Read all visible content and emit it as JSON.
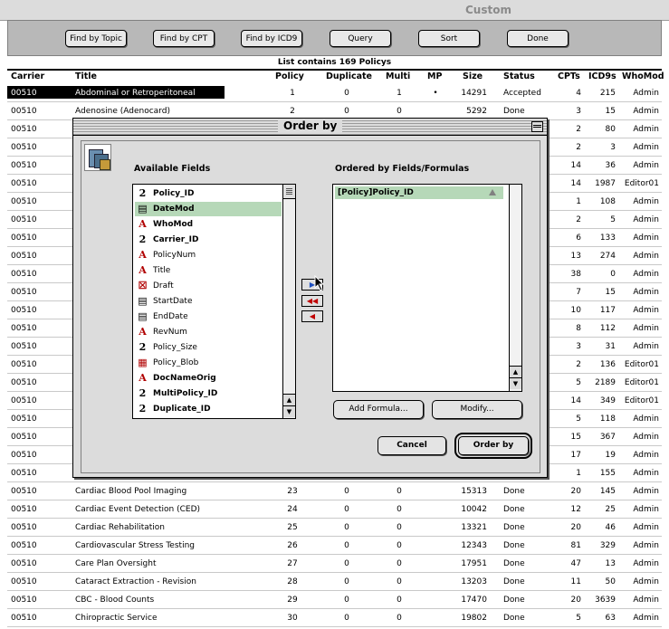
{
  "window": {
    "title": "Custom"
  },
  "toolbar": {
    "buttons": [
      "Find by Topic",
      "Find by CPT",
      "Find by ICD9",
      "Query",
      "Sort",
      "Done"
    ]
  },
  "list_status": "List contains 169 Policys",
  "columns": [
    "Carrier",
    "Title",
    "Policy",
    "Duplicate",
    "Multi",
    "MP",
    "Size",
    "Status",
    "CPTs",
    "ICD9s",
    "WhoMod"
  ],
  "rows": [
    {
      "carrier": "00510",
      "title": "Abdominal or Retroperitoneal",
      "policy": "1",
      "dup": "0",
      "multi": "1",
      "mp": "•",
      "size": "14291",
      "status": "Accepted",
      "cpts": "4",
      "icd": "215",
      "who": "Admin",
      "selected": true
    },
    {
      "carrier": "00510",
      "title": "Adenosine (Adenocard)",
      "policy": "2",
      "dup": "0",
      "multi": "0",
      "mp": "",
      "size": "5292",
      "status": "Done",
      "cpts": "3",
      "icd": "15",
      "who": "Admin"
    },
    {
      "carrier": "00510",
      "title": "",
      "policy": "",
      "dup": "",
      "multi": "",
      "mp": "",
      "size": "",
      "status": "",
      "cpts": "2",
      "icd": "80",
      "who": "Admin"
    },
    {
      "carrier": "00510",
      "title": "",
      "policy": "",
      "dup": "",
      "multi": "",
      "mp": "",
      "size": "",
      "status": "",
      "cpts": "2",
      "icd": "3",
      "who": "Admin"
    },
    {
      "carrier": "00510",
      "title": "",
      "policy": "",
      "dup": "",
      "multi": "",
      "mp": "",
      "size": "",
      "status": "",
      "cpts": "14",
      "icd": "36",
      "who": "Admin"
    },
    {
      "carrier": "00510",
      "title": "",
      "policy": "",
      "dup": "",
      "multi": "",
      "mp": "",
      "size": "",
      "status": "",
      "cpts": "14",
      "icd": "1987",
      "who": "Editor01"
    },
    {
      "carrier": "00510",
      "title": "",
      "policy": "",
      "dup": "",
      "multi": "",
      "mp": "",
      "size": "",
      "status": "",
      "cpts": "1",
      "icd": "108",
      "who": "Admin"
    },
    {
      "carrier": "00510",
      "title": "",
      "policy": "",
      "dup": "",
      "multi": "",
      "mp": "",
      "size": "",
      "status": "",
      "cpts": "2",
      "icd": "5",
      "who": "Admin"
    },
    {
      "carrier": "00510",
      "title": "",
      "policy": "",
      "dup": "",
      "multi": "",
      "mp": "",
      "size": "",
      "status": "",
      "cpts": "6",
      "icd": "133",
      "who": "Admin"
    },
    {
      "carrier": "00510",
      "title": "",
      "policy": "",
      "dup": "",
      "multi": "",
      "mp": "",
      "size": "",
      "status": "",
      "cpts": "13",
      "icd": "274",
      "who": "Admin"
    },
    {
      "carrier": "00510",
      "title": "",
      "policy": "",
      "dup": "",
      "multi": "",
      "mp": "",
      "size": "",
      "status": "",
      "cpts": "38",
      "icd": "0",
      "who": "Admin"
    },
    {
      "carrier": "00510",
      "title": "",
      "policy": "",
      "dup": "",
      "multi": "",
      "mp": "",
      "size": "",
      "status": "",
      "cpts": "7",
      "icd": "15",
      "who": "Admin"
    },
    {
      "carrier": "00510",
      "title": "",
      "policy": "",
      "dup": "",
      "multi": "",
      "mp": "",
      "size": "",
      "status": "",
      "cpts": "10",
      "icd": "117",
      "who": "Admin"
    },
    {
      "carrier": "00510",
      "title": "",
      "policy": "",
      "dup": "",
      "multi": "",
      "mp": "",
      "size": "",
      "status": "",
      "cpts": "8",
      "icd": "112",
      "who": "Admin"
    },
    {
      "carrier": "00510",
      "title": "",
      "policy": "",
      "dup": "",
      "multi": "",
      "mp": "",
      "size": "",
      "status": "",
      "cpts": "3",
      "icd": "31",
      "who": "Admin"
    },
    {
      "carrier": "00510",
      "title": "",
      "policy": "",
      "dup": "",
      "multi": "",
      "mp": "",
      "size": "",
      "status": "",
      "cpts": "2",
      "icd": "136",
      "who": "Editor01"
    },
    {
      "carrier": "00510",
      "title": "",
      "policy": "",
      "dup": "",
      "multi": "",
      "mp": "",
      "size": "",
      "status": "",
      "cpts": "5",
      "icd": "2189",
      "who": "Editor01"
    },
    {
      "carrier": "00510",
      "title": "",
      "policy": "",
      "dup": "",
      "multi": "",
      "mp": "",
      "size": "",
      "status": "",
      "cpts": "14",
      "icd": "349",
      "who": "Editor01"
    },
    {
      "carrier": "00510",
      "title": "",
      "policy": "",
      "dup": "",
      "multi": "",
      "mp": "",
      "size": "",
      "status": "",
      "cpts": "5",
      "icd": "118",
      "who": "Admin"
    },
    {
      "carrier": "00510",
      "title": "",
      "policy": "",
      "dup": "",
      "multi": "",
      "mp": "",
      "size": "",
      "status": "",
      "cpts": "15",
      "icd": "367",
      "who": "Admin"
    },
    {
      "carrier": "00510",
      "title": "",
      "policy": "",
      "dup": "",
      "multi": "",
      "mp": "",
      "size": "",
      "status": "",
      "cpts": "17",
      "icd": "19",
      "who": "Admin"
    },
    {
      "carrier": "00510",
      "title": "",
      "policy": "",
      "dup": "",
      "multi": "",
      "mp": "",
      "size": "",
      "status": "",
      "cpts": "1",
      "icd": "155",
      "who": "Admin"
    },
    {
      "carrier": "00510",
      "title": "Cardiac Blood Pool Imaging",
      "policy": "23",
      "dup": "0",
      "multi": "0",
      "mp": "",
      "size": "15313",
      "status": "Done",
      "cpts": "20",
      "icd": "145",
      "who": "Admin"
    },
    {
      "carrier": "00510",
      "title": "Cardiac Event Detection (CED)",
      "policy": "24",
      "dup": "0",
      "multi": "0",
      "mp": "",
      "size": "10042",
      "status": "Done",
      "cpts": "12",
      "icd": "25",
      "who": "Admin"
    },
    {
      "carrier": "00510",
      "title": "Cardiac Rehabilitation",
      "policy": "25",
      "dup": "0",
      "multi": "0",
      "mp": "",
      "size": "13321",
      "status": "Done",
      "cpts": "20",
      "icd": "46",
      "who": "Admin"
    },
    {
      "carrier": "00510",
      "title": "Cardiovascular Stress Testing",
      "policy": "26",
      "dup": "0",
      "multi": "0",
      "mp": "",
      "size": "12343",
      "status": "Done",
      "cpts": "81",
      "icd": "329",
      "who": "Admin"
    },
    {
      "carrier": "00510",
      "title": "Care Plan Oversight",
      "policy": "27",
      "dup": "0",
      "multi": "0",
      "mp": "",
      "size": "17951",
      "status": "Done",
      "cpts": "47",
      "icd": "13",
      "who": "Admin"
    },
    {
      "carrier": "00510",
      "title": "Cataract Extraction - Revision",
      "policy": "28",
      "dup": "0",
      "multi": "0",
      "mp": "",
      "size": "13203",
      "status": "Done",
      "cpts": "11",
      "icd": "50",
      "who": "Admin"
    },
    {
      "carrier": "00510",
      "title": "CBC - Blood Counts",
      "policy": "29",
      "dup": "0",
      "multi": "0",
      "mp": "",
      "size": "17470",
      "status": "Done",
      "cpts": "20",
      "icd": "3639",
      "who": "Admin"
    },
    {
      "carrier": "00510",
      "title": "Chiropractic Service",
      "policy": "30",
      "dup": "0",
      "multi": "0",
      "mp": "",
      "size": "19802",
      "status": "Done",
      "cpts": "5",
      "icd": "63",
      "who": "Admin"
    }
  ],
  "dialog": {
    "title": "Order by",
    "available_label": "Available Fields",
    "ordered_label": "Ordered by Fields/Formulas",
    "available_fields": [
      {
        "name": "Policy_ID",
        "type": "number",
        "bold": true
      },
      {
        "name": "DateMod",
        "type": "date",
        "bold": true,
        "selected": true
      },
      {
        "name": "WhoMod",
        "type": "text",
        "bold": true
      },
      {
        "name": "Carrier_ID",
        "type": "number",
        "bold": true
      },
      {
        "name": "PolicyNum",
        "type": "text"
      },
      {
        "name": "Title",
        "type": "text"
      },
      {
        "name": "Draft",
        "type": "boolean"
      },
      {
        "name": "StartDate",
        "type": "date"
      },
      {
        "name": "EndDate",
        "type": "date"
      },
      {
        "name": "RevNum",
        "type": "text"
      },
      {
        "name": "Policy_Size",
        "type": "number"
      },
      {
        "name": "Policy_Blob",
        "type": "blob"
      },
      {
        "name": "DocNameOrig",
        "type": "text",
        "bold": true
      },
      {
        "name": "MultiPolicy_ID",
        "type": "number",
        "bold": true
      },
      {
        "name": "Duplicate_ID",
        "type": "number",
        "bold": true
      }
    ],
    "ordered_fields": [
      "[Policy]Policy_ID"
    ],
    "add_formula_label": "Add Formula...",
    "modify_label": "Modify...",
    "cancel_label": "Cancel",
    "order_by_label": "Order by"
  }
}
